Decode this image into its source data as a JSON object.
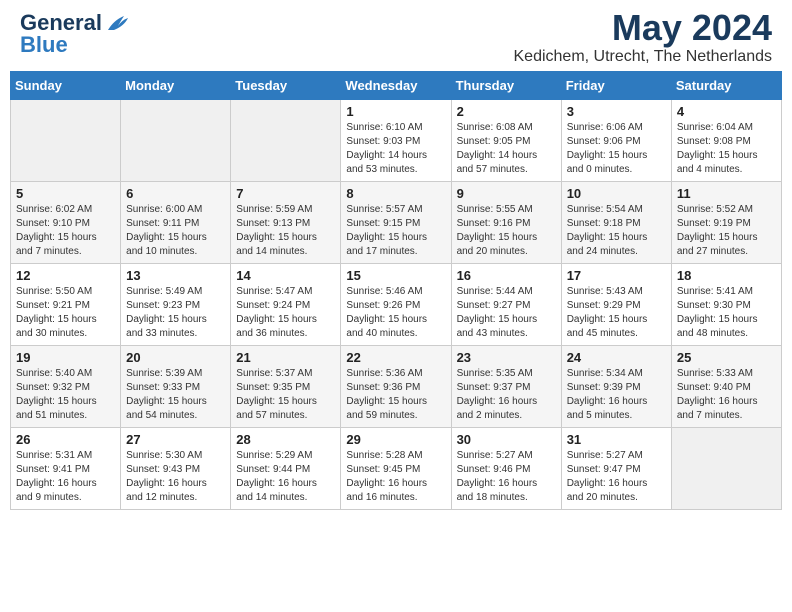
{
  "header": {
    "logo_general": "General",
    "logo_blue": "Blue",
    "month_title": "May 2024",
    "location": "Kedichem, Utrecht, The Netherlands"
  },
  "weekdays": [
    "Sunday",
    "Monday",
    "Tuesday",
    "Wednesday",
    "Thursday",
    "Friday",
    "Saturday"
  ],
  "weeks": [
    [
      {
        "day": "",
        "info": ""
      },
      {
        "day": "",
        "info": ""
      },
      {
        "day": "",
        "info": ""
      },
      {
        "day": "1",
        "info": "Sunrise: 6:10 AM\nSunset: 9:03 PM\nDaylight: 14 hours\nand 53 minutes."
      },
      {
        "day": "2",
        "info": "Sunrise: 6:08 AM\nSunset: 9:05 PM\nDaylight: 14 hours\nand 57 minutes."
      },
      {
        "day": "3",
        "info": "Sunrise: 6:06 AM\nSunset: 9:06 PM\nDaylight: 15 hours\nand 0 minutes."
      },
      {
        "day": "4",
        "info": "Sunrise: 6:04 AM\nSunset: 9:08 PM\nDaylight: 15 hours\nand 4 minutes."
      }
    ],
    [
      {
        "day": "5",
        "info": "Sunrise: 6:02 AM\nSunset: 9:10 PM\nDaylight: 15 hours\nand 7 minutes."
      },
      {
        "day": "6",
        "info": "Sunrise: 6:00 AM\nSunset: 9:11 PM\nDaylight: 15 hours\nand 10 minutes."
      },
      {
        "day": "7",
        "info": "Sunrise: 5:59 AM\nSunset: 9:13 PM\nDaylight: 15 hours\nand 14 minutes."
      },
      {
        "day": "8",
        "info": "Sunrise: 5:57 AM\nSunset: 9:15 PM\nDaylight: 15 hours\nand 17 minutes."
      },
      {
        "day": "9",
        "info": "Sunrise: 5:55 AM\nSunset: 9:16 PM\nDaylight: 15 hours\nand 20 minutes."
      },
      {
        "day": "10",
        "info": "Sunrise: 5:54 AM\nSunset: 9:18 PM\nDaylight: 15 hours\nand 24 minutes."
      },
      {
        "day": "11",
        "info": "Sunrise: 5:52 AM\nSunset: 9:19 PM\nDaylight: 15 hours\nand 27 minutes."
      }
    ],
    [
      {
        "day": "12",
        "info": "Sunrise: 5:50 AM\nSunset: 9:21 PM\nDaylight: 15 hours\nand 30 minutes."
      },
      {
        "day": "13",
        "info": "Sunrise: 5:49 AM\nSunset: 9:23 PM\nDaylight: 15 hours\nand 33 minutes."
      },
      {
        "day": "14",
        "info": "Sunrise: 5:47 AM\nSunset: 9:24 PM\nDaylight: 15 hours\nand 36 minutes."
      },
      {
        "day": "15",
        "info": "Sunrise: 5:46 AM\nSunset: 9:26 PM\nDaylight: 15 hours\nand 40 minutes."
      },
      {
        "day": "16",
        "info": "Sunrise: 5:44 AM\nSunset: 9:27 PM\nDaylight: 15 hours\nand 43 minutes."
      },
      {
        "day": "17",
        "info": "Sunrise: 5:43 AM\nSunset: 9:29 PM\nDaylight: 15 hours\nand 45 minutes."
      },
      {
        "day": "18",
        "info": "Sunrise: 5:41 AM\nSunset: 9:30 PM\nDaylight: 15 hours\nand 48 minutes."
      }
    ],
    [
      {
        "day": "19",
        "info": "Sunrise: 5:40 AM\nSunset: 9:32 PM\nDaylight: 15 hours\nand 51 minutes."
      },
      {
        "day": "20",
        "info": "Sunrise: 5:39 AM\nSunset: 9:33 PM\nDaylight: 15 hours\nand 54 minutes."
      },
      {
        "day": "21",
        "info": "Sunrise: 5:37 AM\nSunset: 9:35 PM\nDaylight: 15 hours\nand 57 minutes."
      },
      {
        "day": "22",
        "info": "Sunrise: 5:36 AM\nSunset: 9:36 PM\nDaylight: 15 hours\nand 59 minutes."
      },
      {
        "day": "23",
        "info": "Sunrise: 5:35 AM\nSunset: 9:37 PM\nDaylight: 16 hours\nand 2 minutes."
      },
      {
        "day": "24",
        "info": "Sunrise: 5:34 AM\nSunset: 9:39 PM\nDaylight: 16 hours\nand 5 minutes."
      },
      {
        "day": "25",
        "info": "Sunrise: 5:33 AM\nSunset: 9:40 PM\nDaylight: 16 hours\nand 7 minutes."
      }
    ],
    [
      {
        "day": "26",
        "info": "Sunrise: 5:31 AM\nSunset: 9:41 PM\nDaylight: 16 hours\nand 9 minutes."
      },
      {
        "day": "27",
        "info": "Sunrise: 5:30 AM\nSunset: 9:43 PM\nDaylight: 16 hours\nand 12 minutes."
      },
      {
        "day": "28",
        "info": "Sunrise: 5:29 AM\nSunset: 9:44 PM\nDaylight: 16 hours\nand 14 minutes."
      },
      {
        "day": "29",
        "info": "Sunrise: 5:28 AM\nSunset: 9:45 PM\nDaylight: 16 hours\nand 16 minutes."
      },
      {
        "day": "30",
        "info": "Sunrise: 5:27 AM\nSunset: 9:46 PM\nDaylight: 16 hours\nand 18 minutes."
      },
      {
        "day": "31",
        "info": "Sunrise: 5:27 AM\nSunset: 9:47 PM\nDaylight: 16 hours\nand 20 minutes."
      },
      {
        "day": "",
        "info": ""
      }
    ]
  ]
}
